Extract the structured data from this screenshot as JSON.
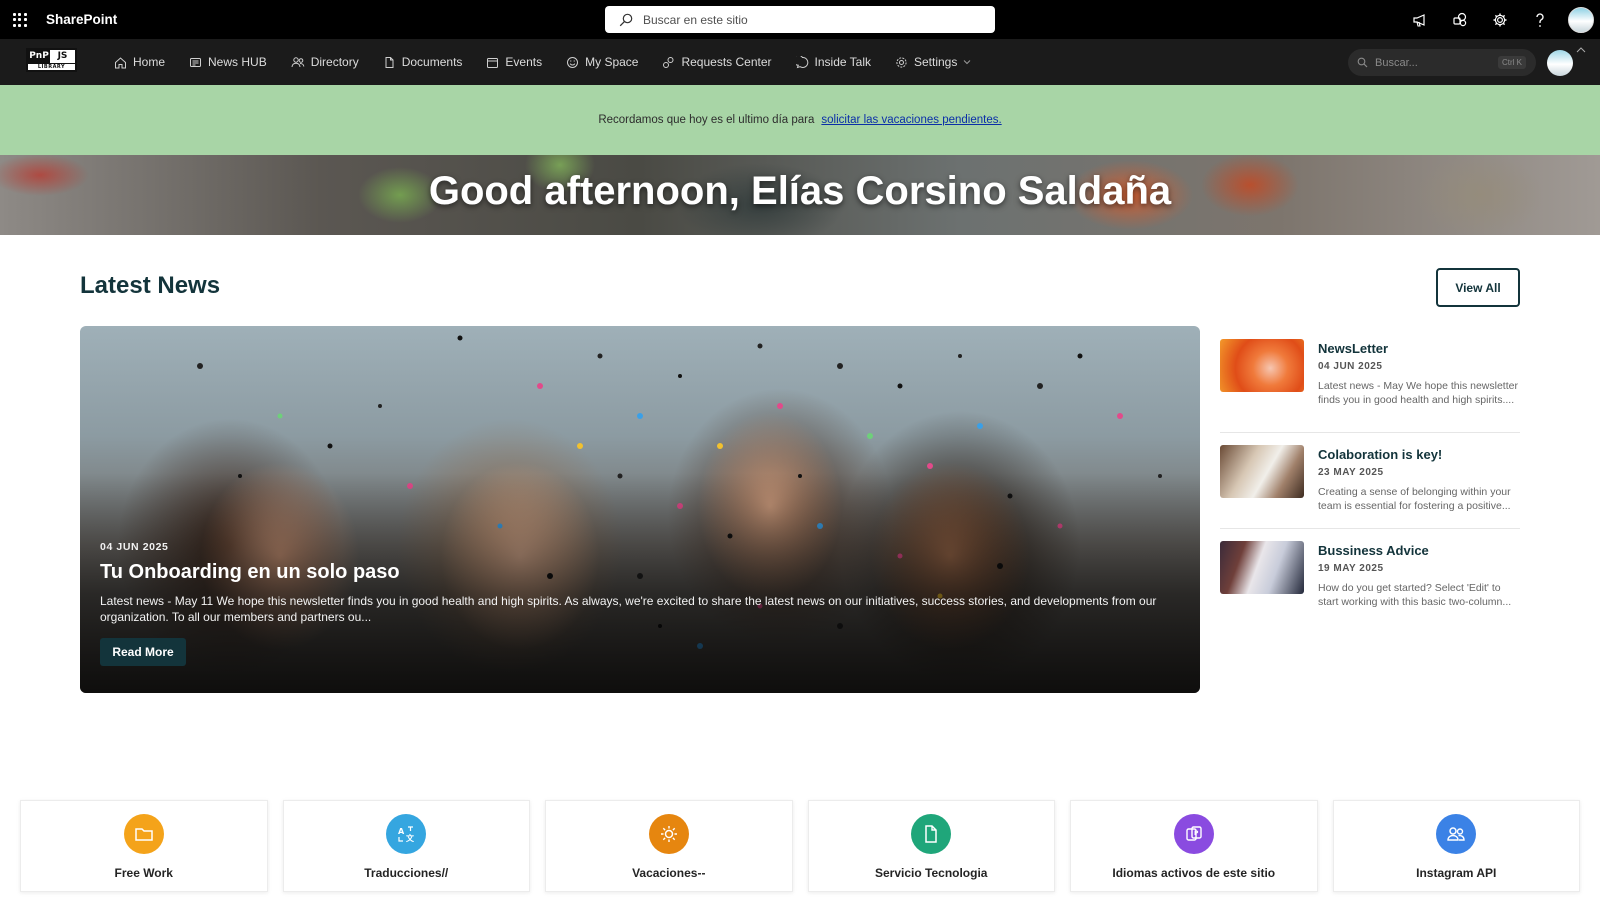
{
  "suite": {
    "app_name": "SharePoint",
    "search_placeholder": "Buscar en este sitio"
  },
  "nav": {
    "logo_pnp": "PnP",
    "logo_js": "JS",
    "logo_library": "LIBRARY",
    "items": [
      {
        "label": "Home",
        "icon": "home-icon"
      },
      {
        "label": "News HUB",
        "icon": "news-icon"
      },
      {
        "label": "Directory",
        "icon": "people-icon"
      },
      {
        "label": "Documents",
        "icon": "documents-icon"
      },
      {
        "label": "Events",
        "icon": "calendar-icon"
      },
      {
        "label": "My Space",
        "icon": "smile-icon"
      },
      {
        "label": "Requests Center",
        "icon": "requests-icon"
      },
      {
        "label": "Inside Talk",
        "icon": "chat-icon"
      },
      {
        "label": "Settings",
        "icon": "gear-icon"
      }
    ],
    "search_placeholder": "Buscar...",
    "search_shortcut": "Ctrl K"
  },
  "announcement": {
    "text": "Recordamos que hoy es el ultimo día para",
    "link": "solicitar las vacaciones pendientes."
  },
  "banner": {
    "greeting": "Good afternoon, Elías Corsino Saldaña"
  },
  "news": {
    "section_title": "Latest News",
    "view_all": "View All",
    "featured": {
      "date": "04 JUN 2025",
      "title": "Tu Onboarding en un solo paso",
      "description": "Latest news - May 11 We hope this newsletter finds you in good health and high spirits. As always, we're excited to share the latest news on our initiatives, success stories, and developments from our organization. To all our members and partners ou...",
      "button": "Read More"
    },
    "items": [
      {
        "title": "NewsLetter",
        "date": "04 JUN 2025",
        "description": "Latest news - May We hope this newsletter finds you in good health and high spirits...."
      },
      {
        "title": "Colaboration is key!",
        "date": "23 MAY 2025",
        "description": "Creating a sense of belonging within your team is essential for fostering a positive..."
      },
      {
        "title": "Bussiness Advice",
        "date": "19 MAY 2025",
        "description": "How do you get started? Select 'Edit' to start working with this basic two-column..."
      }
    ]
  },
  "quick_links": [
    {
      "label": "Free Work",
      "color": "#f4a31a",
      "icon": "folder-icon"
    },
    {
      "label": "Traducciones//",
      "color": "#35a6e0",
      "icon": "translate-icon"
    },
    {
      "label": "Vacaciones--",
      "color": "#e6860f",
      "icon": "sun-icon"
    },
    {
      "label": "Servicio Tecnologia",
      "color": "#1fa67a",
      "icon": "document-icon"
    },
    {
      "label": "Idiomas activos de este sitio",
      "color": "#8a4be0",
      "icon": "language-icon"
    },
    {
      "label": "Instagram API",
      "color": "#3b82e6",
      "icon": "people-icon"
    }
  ]
}
